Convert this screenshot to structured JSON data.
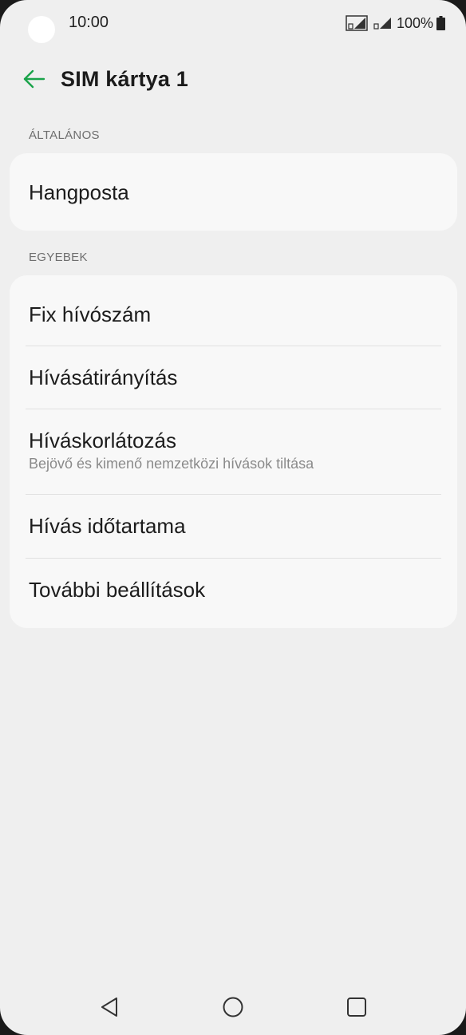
{
  "status_bar": {
    "time": "10:00",
    "battery": "100%"
  },
  "app_bar": {
    "title": "SIM kártya 1",
    "back_icon": "arrow-left-icon"
  },
  "colors": {
    "accent": "#1aa34a",
    "background": "#efefef",
    "card": "#f8f8f8"
  },
  "sections": [
    {
      "header": "ÁLTALÁNOS",
      "items": [
        {
          "title": "Hangposta"
        }
      ]
    },
    {
      "header": "EGYEBEK",
      "items": [
        {
          "title": "Fix hívószám"
        },
        {
          "title": "Hívásátirányítás"
        },
        {
          "title": "Híváskorlátozás",
          "subtitle": "Bejövő és kimenő nemzetközi hívások tiltása"
        },
        {
          "title": "Hívás időtartama"
        },
        {
          "title": "További beállítások"
        }
      ]
    }
  ],
  "nav_bar": {
    "back_icon": "triangle-back-icon",
    "home_icon": "circle-home-icon",
    "recents_icon": "square-recents-icon"
  }
}
